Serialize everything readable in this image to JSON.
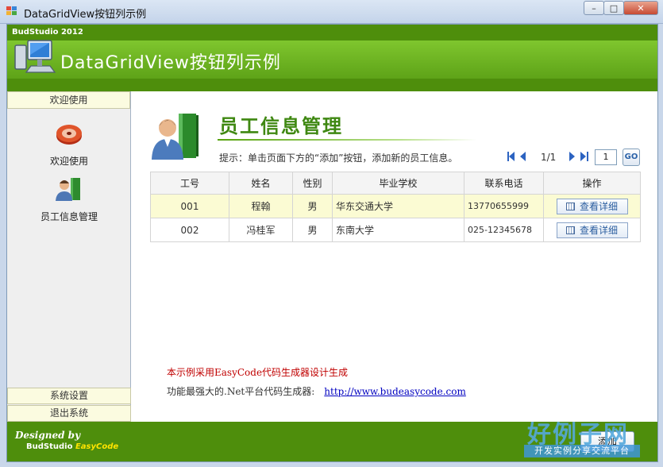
{
  "window": {
    "title": "DataGridView按钮列示例",
    "min": "–",
    "max": "□",
    "close": "✕"
  },
  "banner": {
    "brand": "BudStudio 2012",
    "title": "DataGridView按钮列示例",
    "color": "#4e8e0c",
    "band": "#7fc62e"
  },
  "sidebar": {
    "header": "欢迎使用",
    "items": [
      {
        "label": "欢迎使用",
        "icon": "disk-icon"
      },
      {
        "label": "员工信息管理",
        "icon": "employee-icon"
      }
    ],
    "footer": [
      {
        "label": "系统设置"
      },
      {
        "label": "退出系统"
      }
    ]
  },
  "main": {
    "title": "员工信息管理",
    "hint": "提示：单击页面下方的“添加”按钮，添加新的员工信息。",
    "pager": {
      "info": "1/1",
      "page": "1",
      "go": "GO"
    }
  },
  "grid": {
    "columns": [
      "工号",
      "姓名",
      "性别",
      "毕业学校",
      "联系电话",
      "操作"
    ],
    "rows": [
      {
        "id": "001",
        "name": "程翰",
        "gender": "男",
        "school": "华东交通大学",
        "phone": "13770655999",
        "action": "查看详细",
        "selected": true
      },
      {
        "id": "002",
        "name": "冯桂军",
        "gender": "男",
        "school": "东南大学",
        "phone": "025-12345678",
        "action": "查看详细",
        "selected": false
      }
    ]
  },
  "notes": {
    "red": "本示例采用EasyCode代码生成器设计生成",
    "line2": "功能最强大的.Net平台代码生成器:",
    "link": "http://www.budeasycode.com"
  },
  "footer": {
    "designed": "Designed by",
    "studio": "BudStudio",
    "product": "EasyCode",
    "add": "添加"
  },
  "watermark": {
    "big": "好例子网",
    "small": "开发实例分享交流平台"
  }
}
